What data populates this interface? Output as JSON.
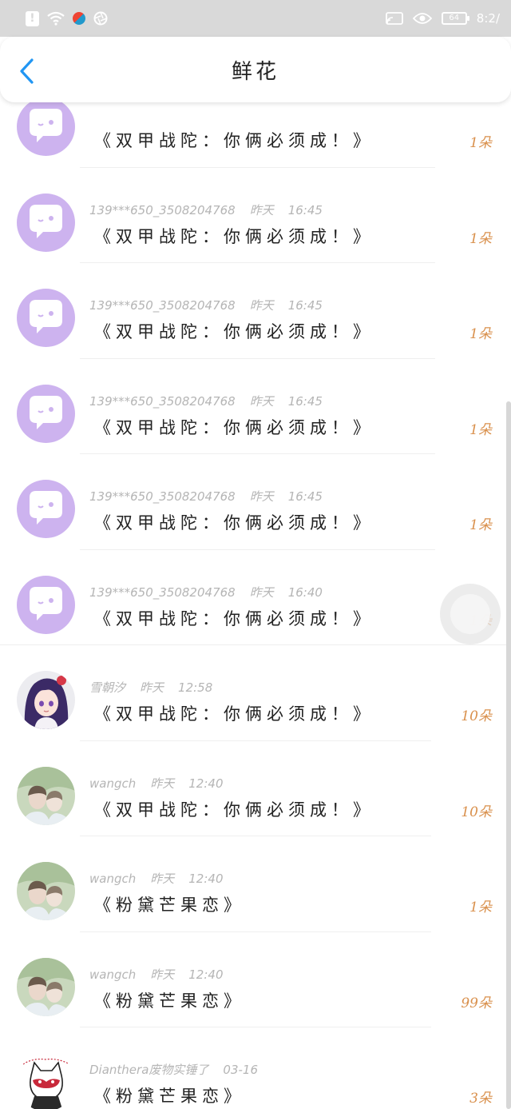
{
  "status_bar": {
    "time": "8:2/",
    "battery": "64",
    "icons": [
      "alert-icon",
      "wifi-icon",
      "bird-app-icon",
      "shutter-app-icon",
      "cast-icon",
      "eye-icon",
      "battery-icon"
    ]
  },
  "header": {
    "title": "鲜花",
    "back_icon": "chevron-left-icon",
    "accent_color": "#2196f3"
  },
  "colors": {
    "count_color": "#d9904c",
    "meta_color": "#b5b5b5",
    "default_avatar": "#cdb3ef"
  },
  "rows": [
    {
      "user": "",
      "date": "",
      "time": "",
      "message": "《双甲战陀：你俩必须成！》",
      "count": "1朵",
      "avatar": "default-avatar-icon"
    },
    {
      "user": "139***650_3508204768",
      "date": "昨天",
      "time": "16:45",
      "message": "《双甲战陀：你俩必须成！》",
      "count": "1朵",
      "avatar": "default-avatar-icon"
    },
    {
      "user": "139***650_3508204768",
      "date": "昨天",
      "time": "16:45",
      "message": "《双甲战陀：你俩必须成！》",
      "count": "1朵",
      "avatar": "default-avatar-icon"
    },
    {
      "user": "139***650_3508204768",
      "date": "昨天",
      "time": "16:45",
      "message": "《双甲战陀：你俩必须成！》",
      "count": "1朵",
      "avatar": "default-avatar-icon"
    },
    {
      "user": "139***650_3508204768",
      "date": "昨天",
      "time": "16:45",
      "message": "《双甲战陀：你俩必须成！》",
      "count": "1朵",
      "avatar": "default-avatar-icon"
    },
    {
      "user": "139***650_3508204768",
      "date": "昨天",
      "time": "16:40",
      "message": "《双甲战陀：你俩必须成！》",
      "count": "1朵",
      "avatar": "default-avatar-icon"
    },
    {
      "user": "雪朝汐",
      "date": "昨天",
      "time": "12:58",
      "message": "《双甲战陀：你俩必须成！》",
      "count": "10朵",
      "avatar": "anime-girl-avatar"
    },
    {
      "user": "wangch",
      "date": "昨天",
      "time": "12:40",
      "message": "《双甲战陀：你俩必须成！》",
      "count": "10朵",
      "avatar": "couple-photo-avatar"
    },
    {
      "user": "wangch",
      "date": "昨天",
      "time": "12:40",
      "message": "《粉黛芒果恋》",
      "count": "1朵",
      "avatar": "couple-photo-avatar"
    },
    {
      "user": "wangch",
      "date": "昨天",
      "time": "12:40",
      "message": "《粉黛芒果恋》",
      "count": "99朵",
      "avatar": "couple-photo-avatar"
    },
    {
      "user": "Dianthera废物实锤了",
      "date": "03-16",
      "time": "",
      "message": "《粉黛芒果恋》",
      "count": "3朵",
      "avatar": "cat-drawing-avatar"
    }
  ],
  "floating_ball_icon": "assistive-ball-icon"
}
